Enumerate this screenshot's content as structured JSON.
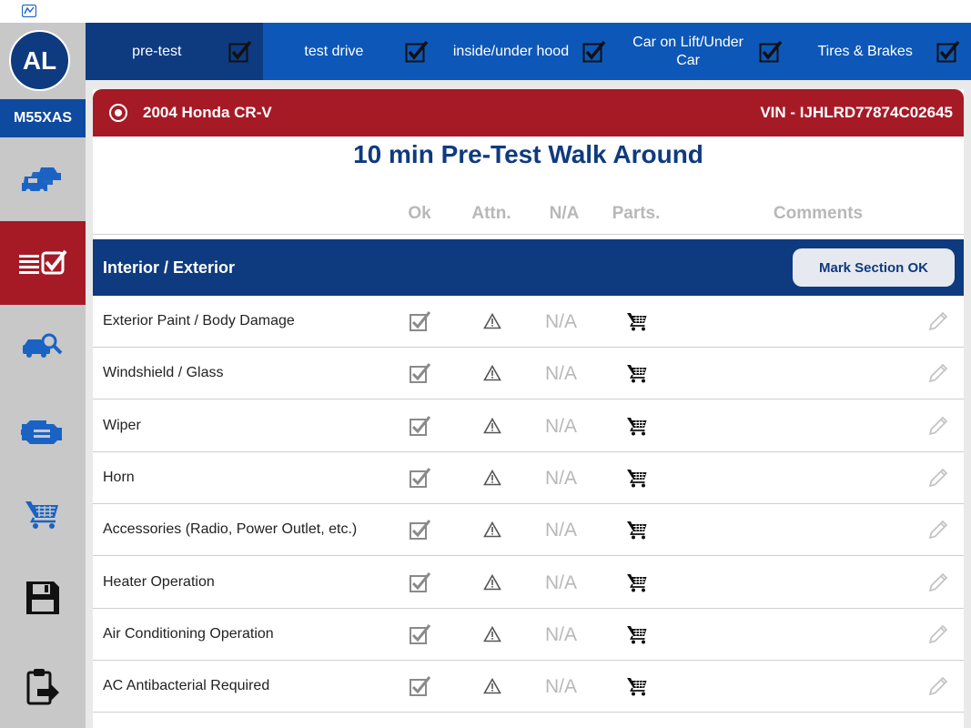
{
  "sidebar": {
    "avatar_initials": "AL",
    "plate": "M55XAS",
    "nav": [
      {
        "icon": "cars-icon",
        "active": false
      },
      {
        "icon": "checklist-icon",
        "active": true
      },
      {
        "icon": "car-search-icon",
        "active": false
      },
      {
        "icon": "engine-icon",
        "active": false
      },
      {
        "icon": "cart-icon",
        "active": false
      },
      {
        "icon": "save-icon",
        "active": false
      },
      {
        "icon": "clipboard-export-icon",
        "active": false
      }
    ]
  },
  "tabs": [
    {
      "label": "pre-test",
      "checked": true,
      "active": true
    },
    {
      "label": "test drive",
      "checked": true,
      "active": false
    },
    {
      "label": "inside/under hood",
      "checked": true,
      "active": false
    },
    {
      "label": "Car on Lift/Under Car",
      "checked": true,
      "active": false
    },
    {
      "label": "Tires & Brakes",
      "checked": true,
      "active": false
    }
  ],
  "vehicle": {
    "name": "2004 Honda CR-V",
    "vin": "VIN - IJHLRD77874C02645"
  },
  "page_title": "10 min Pre-Test Walk Around",
  "columns": {
    "ok": "Ok",
    "attn": "Attn.",
    "na": "N/A",
    "parts": "Parts.",
    "comments": "Comments"
  },
  "section": {
    "title": "Interior / Exterior",
    "mark_ok_label": "Mark Section OK"
  },
  "items": [
    {
      "label": "Exterior Paint / Body Damage",
      "na": "N/A"
    },
    {
      "label": "Windshield / Glass",
      "na": "N/A"
    },
    {
      "label": "Wiper",
      "na": "N/A"
    },
    {
      "label": "Horn",
      "na": "N/A"
    },
    {
      "label": "Accessories (Radio, Power Outlet, etc.)",
      "na": "N/A"
    },
    {
      "label": "Heater Operation",
      "na": "N/A"
    },
    {
      "label": "Air Conditioning Operation",
      "na": "N/A"
    },
    {
      "label": "AC Antibacterial Required",
      "na": "N/A"
    }
  ],
  "colors": {
    "brand_navy": "#0e3a80",
    "tab_blue": "#0d57b8",
    "accent_red": "#a61a26"
  }
}
